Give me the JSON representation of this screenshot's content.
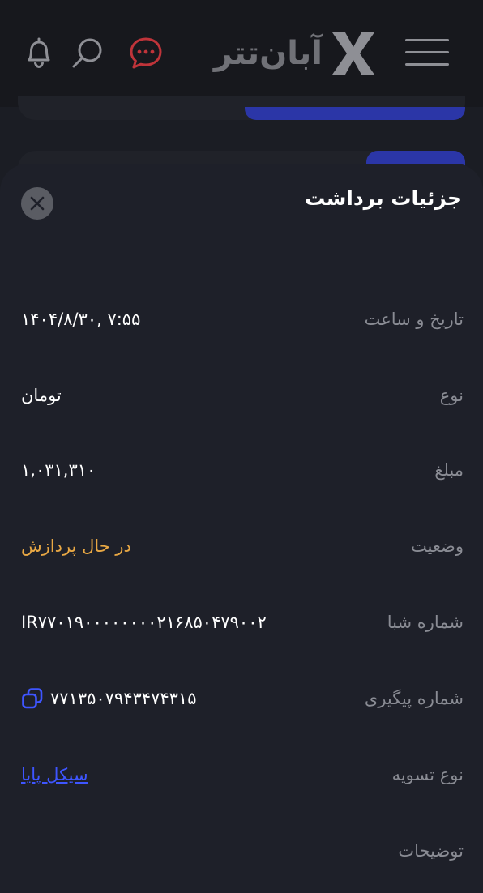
{
  "header": {
    "brand_name": "آبان‌تتر",
    "icons": [
      "hamburger-menu-icon",
      "x-logo-icon",
      "chat-icon",
      "search-icon",
      "bell-icon"
    ],
    "colors": {
      "chat_icon": "#c0343a",
      "icon_gray": "#8e8f95",
      "brand_gray": "#707177"
    }
  },
  "sheet": {
    "title": "جزئیات برداشت",
    "rows": [
      {
        "label": "تاریخ و ساعت",
        "value": "۱۴۰۴/۸/۳۰, ۷:۵۵"
      },
      {
        "label": "نوع",
        "value": "تومان"
      },
      {
        "label": "مبلغ",
        "value": "۱,۰۳۱,۳۱۰"
      },
      {
        "label": "وضعیت",
        "value": "در حال پردازش"
      },
      {
        "label": "شماره شبا",
        "value": "IR۷۷۰۱۹۰۰۰۰۰۰۰۰۲۱۶۸۵۰۴۷۹۰۰۲"
      },
      {
        "label": "شماره پیگیری",
        "value": "۷۷۱۳۵۰۷۹۴۳۴۷۴۳۱۵"
      },
      {
        "label": "نوع تسویه",
        "value": "سیکل پایا"
      },
      {
        "label": "توضیحات",
        "value": ""
      }
    ],
    "colors": {
      "status": "#e9a844",
      "link": "#3e55ff",
      "accent": "#2b36a7"
    }
  }
}
